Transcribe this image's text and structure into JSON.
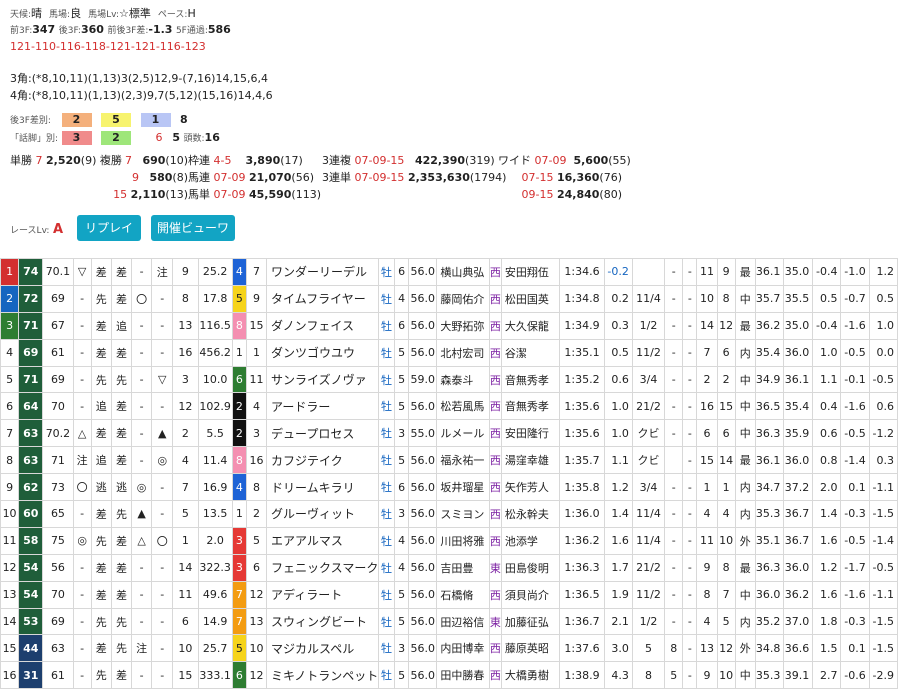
{
  "header": {
    "weather_label": "天候:",
    "weather": "晴",
    "track_label": "馬場:",
    "track": "良",
    "level_label": "馬場Lv:",
    "level": "☆標準",
    "pace_label": "ペース:",
    "pace": "H",
    "first3f_label": "前3F:",
    "first3f": "347",
    "last3f_label": "後3F:",
    "last3f": "360",
    "diff_label": "前後3F差:",
    "diff": "-1.3",
    "f5_label": "5F通過:",
    "f5": "586",
    "laps": "121-110-116-118-121-121-116-123",
    "corner3_label": "3角:",
    "corner3": "(*8,10,11)(1,13)3(2,5)12,9-(7,16)14,15,6,4",
    "corner4_label": "4角:",
    "corner4": "(*8,10,11)(1,13)(2,3)9,7(5,12)(15,16)14,4,6",
    "last3f_row_label": "後3F差別:",
    "last3f_boxes": [
      "2",
      "5",
      "1"
    ],
    "last3f_box_colors": [
      "#f4b07c",
      "#f7f36e",
      "#b9c6f5"
    ],
    "last3f_rest": "8",
    "style_row_label": "「話脚」別:",
    "style_boxes": [
      "3",
      "2"
    ],
    "style_box_colors": [
      "#f08b8b",
      "#9ee67a"
    ],
    "style_extra": "6",
    "style_extra2": "5",
    "heads_label": "頭数:",
    "heads": "16"
  },
  "payouts": {
    "tansho_label": "単勝",
    "tansho_num": "7",
    "tansho_val": "2,520",
    "tansho_pop": "(9)",
    "fukusho_label": "複勝",
    "fukusho": [
      [
        "7",
        "690",
        "(10)"
      ],
      [
        "9",
        "580",
        "(8)"
      ],
      [
        "15",
        "2,110",
        "(13)"
      ]
    ],
    "wakuren_label": "枠連",
    "wakuren_num": "4-5",
    "wakuren_val": "3,890",
    "wakuren_pop": "(17)",
    "umaren_label": "馬連",
    "umaren_num": "07-09",
    "umaren_val": "21,070",
    "umaren_pop": "(56)",
    "umatan_label": "馬単",
    "umatan_num": "07-09",
    "umatan_val": "45,590",
    "umatan_pop": "(113)",
    "fuku3_label": "3連複",
    "fuku3_num": "07-09-15",
    "fuku3_val": "422,390",
    "fuku3_pop": "(319)",
    "tan3_label": "3連単",
    "tan3_num": "07-09-15",
    "tan3_val": "2,353,630",
    "tan3_pop": "(1794)",
    "wide_label": "ワイド",
    "wide": [
      [
        "07-09",
        "5,600",
        "(55)"
      ],
      [
        "07-15",
        "16,360",
        "(76)"
      ],
      [
        "09-15",
        "24,840",
        "(80)"
      ]
    ]
  },
  "race_level_label": "レースLv:",
  "race_level": "A",
  "buttons": {
    "replay": "リプレイ",
    "kaisai": "開催ビューワ"
  },
  "rows": [
    [
      "1",
      "74",
      "70.1",
      "▽",
      "差",
      "差",
      "-",
      "注",
      "9",
      "25.2",
      "4",
      "7",
      "ワンダーリーデル",
      "牡",
      "6",
      "56.0",
      "横山典弘",
      "西",
      "安田翔伍",
      "1:34.6",
      "-0.2",
      "",
      "-",
      "-",
      "11",
      "9",
      "最",
      "36.1",
      "35.0",
      "-0.4",
      "-1.0",
      "1.2"
    ],
    [
      "2",
      "72",
      "69",
      "-",
      "先",
      "差",
      "〇",
      "-",
      "8",
      "17.8",
      "5",
      "9",
      "タイムフライヤー",
      "牡",
      "4",
      "56.0",
      "藤岡佑介",
      "西",
      "松田国英",
      "1:34.8",
      "0.2",
      "11/4",
      "-",
      "-",
      "10",
      "8",
      "中",
      "35.7",
      "35.5",
      "0.5",
      "-0.7",
      "0.5"
    ],
    [
      "3",
      "71",
      "67",
      "-",
      "差",
      "追",
      "-",
      "-",
      "13",
      "116.5",
      "8",
      "15",
      "ダノンフェイス",
      "牡",
      "6",
      "56.0",
      "大野拓弥",
      "西",
      "大久保龍",
      "1:34.9",
      "0.3",
      "1/2",
      "-",
      "-",
      "14",
      "12",
      "最",
      "36.2",
      "35.0",
      "-0.4",
      "-1.6",
      "1.0"
    ],
    [
      "4",
      "69",
      "61",
      "-",
      "差",
      "差",
      "-",
      "-",
      "16",
      "456.2",
      "1",
      "1",
      "ダンツゴウユウ",
      "牡",
      "5",
      "56.0",
      "北村宏司",
      "西",
      "谷潔",
      "1:35.1",
      "0.5",
      "11/2",
      "-",
      "-",
      "7",
      "6",
      "内",
      "35.4",
      "36.0",
      "1.0",
      "-0.5",
      "0.0"
    ],
    [
      "5",
      "71",
      "69",
      "-",
      "先",
      "先",
      "-",
      "▽",
      "3",
      "10.0",
      "6",
      "11",
      "サンライズノヴァ",
      "牡",
      "5",
      "59.0",
      "森泰斗",
      "西",
      "音無秀孝",
      "1:35.2",
      "0.6",
      "3/4",
      "-",
      "-",
      "2",
      "2",
      "中",
      "34.9",
      "36.1",
      "1.1",
      "-0.1",
      "-0.5"
    ],
    [
      "6",
      "64",
      "70",
      "-",
      "追",
      "差",
      "-",
      "-",
      "12",
      "102.9",
      "2",
      "4",
      "アードラー",
      "牡",
      "5",
      "56.0",
      "松若風馬",
      "西",
      "音無秀孝",
      "1:35.6",
      "1.0",
      "21/2",
      "-",
      "-",
      "16",
      "15",
      "中",
      "36.5",
      "35.4",
      "0.4",
      "-1.6",
      "0.6"
    ],
    [
      "7",
      "63",
      "70.2",
      "△",
      "差",
      "差",
      "-",
      "▲",
      "2",
      "5.5",
      "2",
      "3",
      "デュープロセス",
      "牡",
      "3",
      "55.0",
      "ルメール",
      "西",
      "安田隆行",
      "1:35.6",
      "1.0",
      "クビ",
      "-",
      "-",
      "6",
      "6",
      "中",
      "36.3",
      "35.9",
      "0.6",
      "-0.5",
      "-1.2"
    ],
    [
      "8",
      "63",
      "71",
      "注",
      "追",
      "差",
      "-",
      "◎",
      "4",
      "11.4",
      "8",
      "16",
      "カフジテイク",
      "牡",
      "5",
      "56.0",
      "福永祐一",
      "西",
      "湯窪幸雄",
      "1:35.7",
      "1.1",
      "クビ",
      "",
      "-",
      "15",
      "14",
      "最",
      "36.1",
      "36.0",
      "0.8",
      "-1.4",
      "0.3"
    ],
    [
      "9",
      "62",
      "73",
      "〇",
      "逃",
      "逃",
      "◎",
      "-",
      "7",
      "16.9",
      "4",
      "8",
      "ドリームキラリ",
      "牡",
      "6",
      "56.0",
      "坂井瑠星",
      "西",
      "矢作芳人",
      "1:35.8",
      "1.2",
      "3/4",
      "-",
      "-",
      "1",
      "1",
      "内",
      "34.7",
      "37.2",
      "2.0",
      "0.1",
      "-1.1"
    ],
    [
      "10",
      "60",
      "65",
      "-",
      "差",
      "先",
      "▲",
      "-",
      "5",
      "13.5",
      "1",
      "2",
      "グルーヴィット",
      "牡",
      "3",
      "56.0",
      "スミヨン",
      "西",
      "松永幹夫",
      "1:36.0",
      "1.4",
      "11/4",
      "-",
      "-",
      "4",
      "4",
      "内",
      "35.3",
      "36.7",
      "1.4",
      "-0.3",
      "-1.5"
    ],
    [
      "11",
      "58",
      "75",
      "◎",
      "先",
      "差",
      "△",
      "〇",
      "1",
      "2.0",
      "3",
      "5",
      "エアアルマス",
      "牡",
      "4",
      "56.0",
      "川田将雅",
      "西",
      "池添学",
      "1:36.2",
      "1.6",
      "11/4",
      "-",
      "-",
      "11",
      "10",
      "外",
      "35.1",
      "36.7",
      "1.6",
      "-0.5",
      "-1.4"
    ],
    [
      "12",
      "54",
      "56",
      "-",
      "差",
      "差",
      "-",
      "-",
      "14",
      "322.3",
      "3",
      "6",
      "フェニックスマーク",
      "牡",
      "4",
      "56.0",
      "吉田豊",
      "東",
      "田島俊明",
      "1:36.3",
      "1.7",
      "21/2",
      "-",
      "-",
      "9",
      "8",
      "最",
      "36.3",
      "36.0",
      "1.2",
      "-1.7",
      "-0.5"
    ],
    [
      "13",
      "54",
      "70",
      "-",
      "差",
      "差",
      "-",
      "-",
      "11",
      "49.6",
      "7",
      "12",
      "アディラート",
      "牡",
      "5",
      "56.0",
      "石橋脩",
      "西",
      "須貝尚介",
      "1:36.5",
      "1.9",
      "11/2",
      "-",
      "-",
      "8",
      "7",
      "中",
      "36.0",
      "36.2",
      "1.6",
      "-1.6",
      "-1.1"
    ],
    [
      "14",
      "53",
      "69",
      "-",
      "先",
      "先",
      "-",
      "-",
      "6",
      "14.9",
      "7",
      "13",
      "スウィングビート",
      "牡",
      "5",
      "56.0",
      "田辺裕信",
      "東",
      "加藤征弘",
      "1:36.7",
      "2.1",
      "1/2",
      "-",
      "-",
      "4",
      "5",
      "内",
      "35.2",
      "37.0",
      "1.8",
      "-0.3",
      "-1.5"
    ],
    [
      "15",
      "44",
      "63",
      "-",
      "差",
      "先",
      "注",
      "-",
      "10",
      "25.7",
      "5",
      "10",
      "マジカルスペル",
      "牡",
      "3",
      "56.0",
      "内田博幸",
      "西",
      "藤原英昭",
      "1:37.6",
      "3.0",
      "5",
      "8",
      "-",
      "13",
      "12",
      "外",
      "34.8",
      "36.6",
      "1.5",
      "0.1",
      "-1.5"
    ],
    [
      "16",
      "31",
      "61",
      "-",
      "先",
      "差",
      "-",
      "-",
      "15",
      "333.1",
      "6",
      "12",
      "ミキノトランペット",
      "牡",
      "5",
      "56.0",
      "田中勝春",
      "西",
      "大橋勇樹",
      "1:38.9",
      "4.3",
      "8",
      "5",
      "-",
      "9",
      "10",
      "中",
      "35.3",
      "39.1",
      "2.7",
      "-0.6",
      "-2.9"
    ]
  ],
  "colors": {
    "accent": "#12a4c4",
    "red": "#d32f2f",
    "blue": "#1565c0",
    "green": "#2e7d32"
  }
}
